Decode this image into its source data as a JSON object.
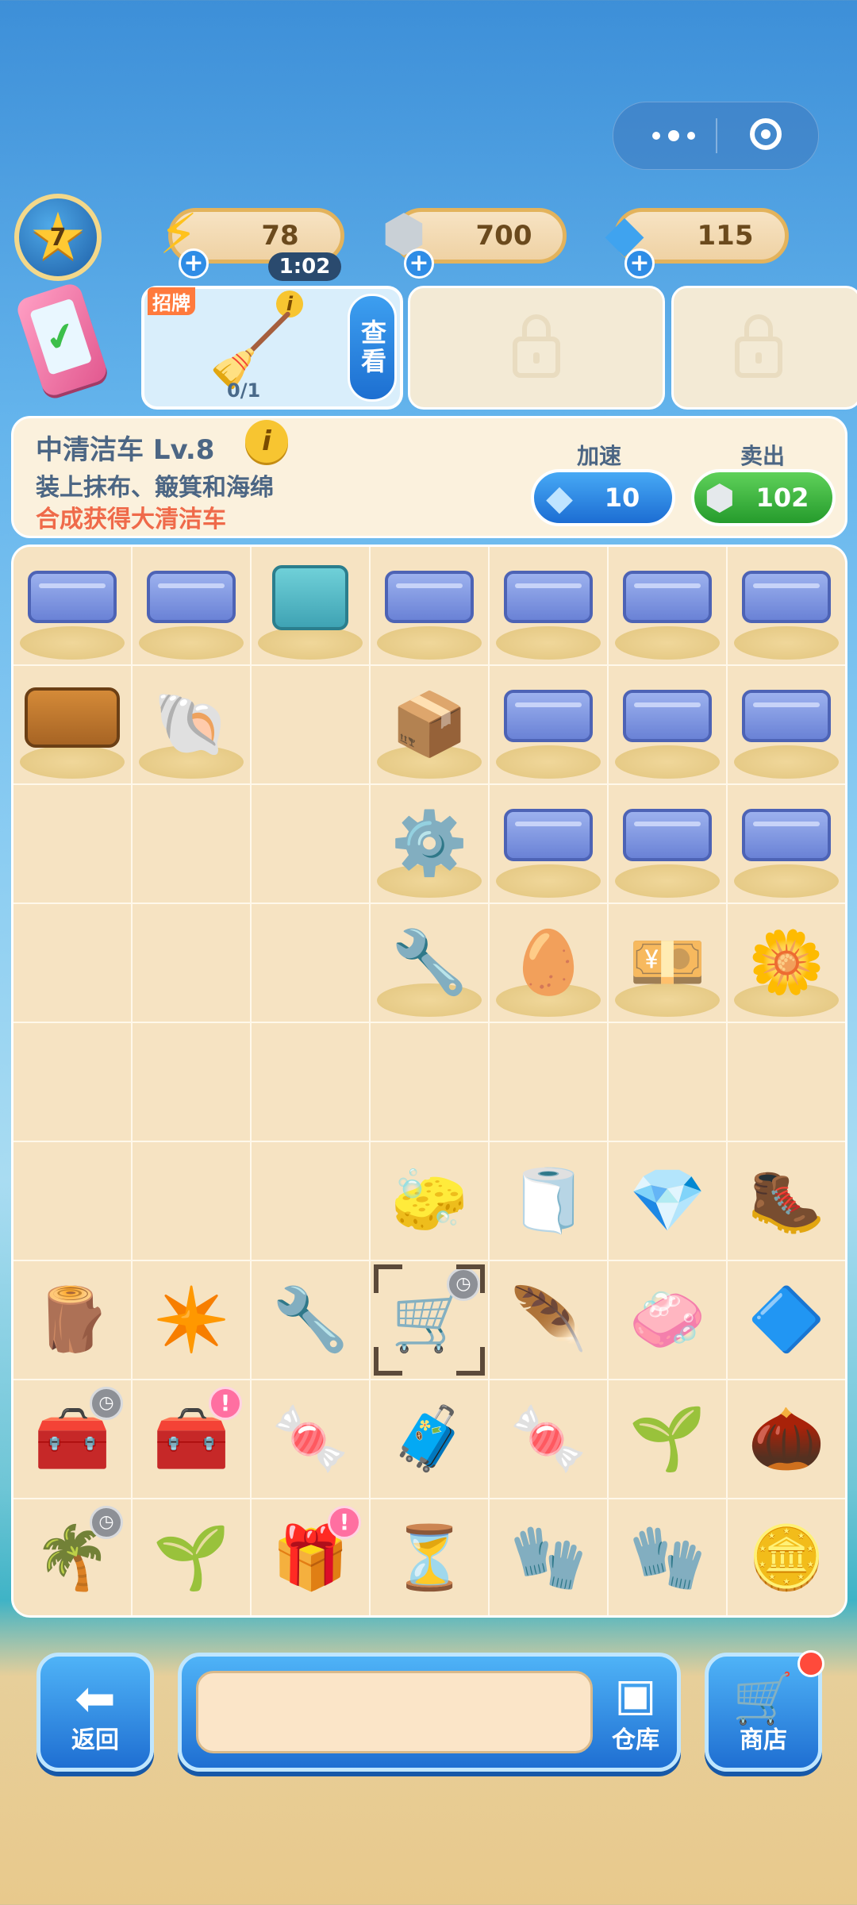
{
  "header": {
    "level": "7",
    "energy": "78",
    "coins": "700",
    "gems": "115",
    "timer": "1:02",
    "plus": "+"
  },
  "orders": {
    "tag": "招牌",
    "info": "i",
    "progress": "0/1",
    "view_label": "查看",
    "broom_icon": "🧹"
  },
  "panel": {
    "title": "中清洁车  Lv.8",
    "info": "i",
    "desc": "装上抹布、簸箕和海绵",
    "hint": "合成获得大清洁车",
    "speed_label": "加速",
    "speed_cost": "10",
    "sell_label": "卖出",
    "sell_value": "102"
  },
  "board": {
    "rows": [
      [
        {
          "t": "crate",
          "s": true
        },
        {
          "t": "crate",
          "s": true
        },
        {
          "t": "box-teal",
          "s": true
        },
        {
          "t": "crate",
          "s": true
        },
        {
          "t": "crate",
          "s": true
        },
        {
          "t": "crate",
          "s": true
        },
        {
          "t": "crate",
          "s": true
        }
      ],
      [
        {
          "t": "box-brown",
          "s": true
        },
        {
          "g": "🐚",
          "s": true
        },
        {},
        {
          "g": "📦",
          "s": true
        },
        {
          "t": "crate",
          "s": true
        },
        {
          "t": "crate",
          "s": true
        },
        {
          "t": "crate",
          "s": true
        }
      ],
      [
        {},
        {},
        {},
        {
          "g": "⚙️",
          "s": true
        },
        {
          "t": "crate",
          "s": true
        },
        {
          "t": "crate",
          "s": true
        },
        {
          "t": "crate",
          "s": true
        }
      ],
      [
        {},
        {},
        {},
        {
          "g": "🔧",
          "s": true
        },
        {
          "g": "🥚",
          "s": true
        },
        {
          "g": "💴",
          "s": true
        },
        {
          "g": "🌼",
          "s": true
        }
      ],
      [
        {},
        {},
        {},
        {},
        {},
        {},
        {}
      ],
      [
        {},
        {},
        {},
        {
          "g": "🧽"
        },
        {
          "g": "🧻"
        },
        {
          "g": "💎"
        },
        {
          "g": "🥾"
        }
      ],
      [
        {
          "g": "🪵"
        },
        {
          "g": "✴️"
        },
        {
          "g": "🔧"
        },
        {
          "g": "🛒",
          "sel": true,
          "b": "clock"
        },
        {
          "g": "🪶"
        },
        {
          "g": "🧼"
        },
        {
          "g": "🔷"
        }
      ],
      [
        {
          "g": "🧰",
          "b": "clock"
        },
        {
          "g": "🧰",
          "b": "alert"
        },
        {
          "g": "🍬"
        },
        {
          "g": "🧳"
        },
        {
          "g": "🍬"
        },
        {
          "g": "🌱"
        },
        {
          "g": "🌰"
        }
      ],
      [
        {
          "g": "🌴",
          "b": "clock"
        },
        {
          "g": "🌱"
        },
        {
          "g": "🎁",
          "b": "alert"
        },
        {
          "g": "⏳"
        },
        {
          "g": "🧤"
        },
        {
          "g": "🧤"
        },
        {
          "g": "🪙"
        }
      ]
    ]
  },
  "bottom": {
    "back_label": "返回",
    "storage_label": "仓库",
    "shop_label": "商店"
  }
}
